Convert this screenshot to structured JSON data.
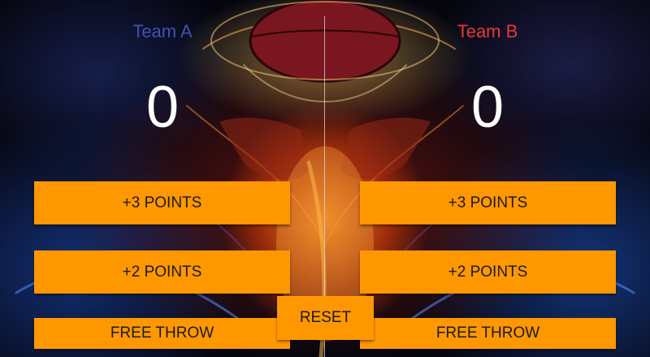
{
  "team_a": {
    "name": "Team A",
    "name_color": "#3f51b5",
    "score": "0",
    "buttons": {
      "three": "+3 POINTS",
      "two": "+2 POINTS",
      "free": "FREE THROW"
    }
  },
  "team_b": {
    "name": "Team B",
    "name_color": "#e53935",
    "score": "0",
    "buttons": {
      "three": "+3 POINTS",
      "two": "+2 POINTS",
      "free": "FREE THROW"
    }
  },
  "reset_label": "RESET",
  "colors": {
    "button": "#ff9800",
    "button_text": "#1a1a1a",
    "score_text": "#ffffff"
  },
  "background_image": "basketball-fire-hands"
}
